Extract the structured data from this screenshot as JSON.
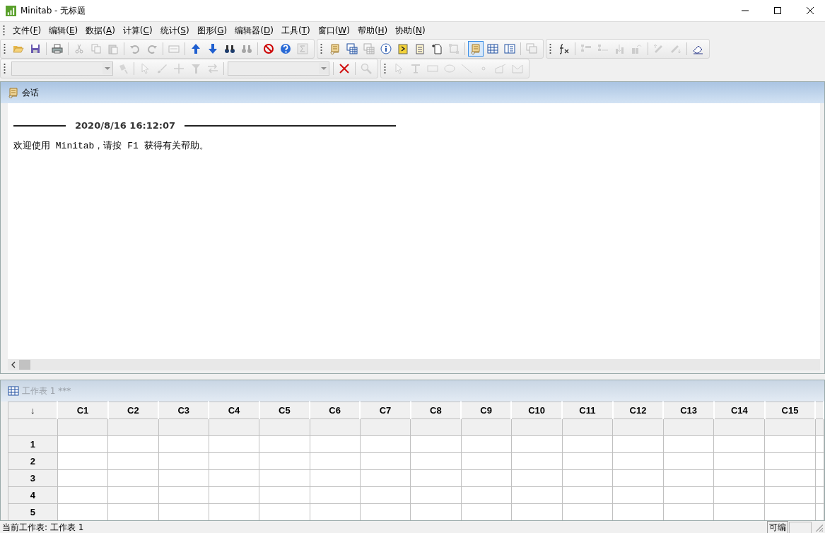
{
  "window": {
    "title": "Minitab - 无标题"
  },
  "menu": [
    "文件(F)",
    "编辑(E)",
    "数据(A)",
    "计算(C)",
    "统计(S)",
    "图形(G)",
    "编辑器(D)",
    "工具(T)",
    "窗口(W)",
    "帮助(H)",
    "协助(N)"
  ],
  "toolbars": [
    [
      {
        "buttons": [
          {
            "kind": "button",
            "disabled": false
          },
          {
            "kind": "button",
            "disabled": false
          },
          {
            "kind": "button",
            "disabled": false
          },
          {
            "kind": "button",
            "disabled": true
          },
          {
            "kind": "button",
            "disabled": true
          },
          {
            "kind": "button",
            "disabled": true
          },
          {
            "kind": "button",
            "disabled": true
          },
          {
            "kind": "button",
            "disabled": true
          },
          {
            "kind": "button",
            "disabled": true
          },
          {
            "kind": "button",
            "disabled": false
          },
          {
            "kind": "button",
            "disabled": false
          },
          {
            "kind": "button",
            "disabled": false
          },
          {
            "kind": "button",
            "disabled": true
          },
          {
            "kind": "button",
            "disabled": false
          },
          {
            "kind": "button",
            "disabled": false
          },
          {
            "kind": "button",
            "disabled": true
          }
        ]
      },
      {
        "buttons": [
          {
            "kind": "button",
            "disabled": false,
            "selected": false
          },
          {
            "kind": "button",
            "disabled": false,
            "selected": false
          },
          {
            "kind": "button",
            "disabled": true,
            "selected": false
          },
          {
            "kind": "button",
            "disabled": false,
            "selected": false
          },
          {
            "kind": "button",
            "disabled": false,
            "selected": false
          },
          {
            "kind": "button",
            "disabled": false,
            "selected": false
          },
          {
            "kind": "button",
            "disabled": false,
            "selected": false
          },
          {
            "kind": "button",
            "disabled": true,
            "selected": false
          },
          {
            "kind": "button",
            "disabled": false,
            "selected": true
          },
          {
            "kind": "button",
            "disabled": false,
            "selected": false
          },
          {
            "kind": "button",
            "disabled": false,
            "selected": false
          },
          {
            "kind": "button",
            "disabled": true,
            "selected": false
          }
        ]
      },
      {
        "buttons": [
          {
            "kind": "button",
            "disabled": false
          },
          {
            "kind": "button",
            "disabled": true
          },
          {
            "kind": "button",
            "disabled": true
          },
          {
            "kind": "button",
            "disabled": true
          },
          {
            "kind": "button",
            "disabled": true
          },
          {
            "kind": "button",
            "disabled": true
          },
          {
            "kind": "button",
            "disabled": true
          },
          {
            "kind": "button",
            "disabled": false
          }
        ]
      }
    ],
    [
      {
        "buttons": [
          {
            "kind": "combo",
            "disabled": true
          },
          {
            "kind": "button",
            "disabled": true
          },
          {
            "kind": "button",
            "disabled": true
          },
          {
            "kind": "button",
            "disabled": true
          },
          {
            "kind": "button",
            "disabled": true
          },
          {
            "kind": "button",
            "disabled": true
          },
          {
            "kind": "button",
            "disabled": true
          },
          {
            "kind": "combo",
            "disabled": true
          },
          {
            "kind": "button",
            "disabled": false
          },
          {
            "kind": "button",
            "disabled": true
          }
        ]
      },
      {
        "buttons": [
          {
            "kind": "button",
            "disabled": true
          },
          {
            "kind": "button",
            "disabled": true
          },
          {
            "kind": "button",
            "disabled": true
          },
          {
            "kind": "button",
            "disabled": true
          },
          {
            "kind": "button",
            "disabled": true
          },
          {
            "kind": "button",
            "disabled": true
          },
          {
            "kind": "button",
            "disabled": true
          },
          {
            "kind": "button",
            "disabled": true
          }
        ]
      }
    ]
  ],
  "session": {
    "title": "会话",
    "timestamp": "2020/8/16 16:12:07",
    "message": "欢迎使用 Minitab，请按 F1 获得有关帮助。"
  },
  "worksheet": {
    "title": "工作表 1 ***",
    "corner": "↓",
    "columns": [
      "C1",
      "C2",
      "C3",
      "C4",
      "C5",
      "C6",
      "C7",
      "C8",
      "C9",
      "C10",
      "C11",
      "C12",
      "C13",
      "C14",
      "C15"
    ],
    "rows": [
      "1",
      "2",
      "3",
      "4",
      "5"
    ]
  },
  "status_bar": {
    "text": "当前工作表: 工作表 1",
    "mode": "可编"
  }
}
